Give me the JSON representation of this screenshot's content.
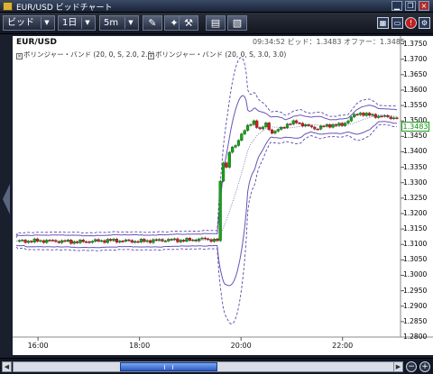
{
  "window": {
    "title": "EUR/USD ビッドチャート",
    "app_icon": "chart-icon",
    "buttons": [
      "minimize-icon",
      "restore-icon",
      "close-icon"
    ]
  },
  "toolbar": {
    "price_type": "ビッド",
    "period": "1日",
    "interval": "5m",
    "tools": [
      "draw-line-icon",
      "pin-icon",
      "indicator-icon",
      "print-icon",
      "image-icon"
    ],
    "right_icons": [
      "layout-icon",
      "window-icon",
      "alert-icon",
      "settings-icon"
    ]
  },
  "chart": {
    "symbol": "EUR/USD",
    "info_time": "09:34:52",
    "info_bid_label": "ビッド：",
    "info_bid": "1.3483",
    "info_offer_label": "オファー：",
    "info_offer": "1.3485",
    "legend_1": "ボリンジャー・バンド (20, 0, S, 2.0, 2.0)",
    "legend_2": "ボリンジャー・バンド (20, 0, S, 3.0, 3.0)",
    "current_price": "1.3483",
    "colors": {
      "background": "#ffffff",
      "up_candle": "#1aa01a",
      "down_candle": "#cc2020",
      "band2": "#6a52b8",
      "band3": "#5a4aa8",
      "middle": "#6a6aa8"
    }
  },
  "chart_data": {
    "type": "candlestick",
    "y_ticks": [
      "1.3750",
      "1.3700",
      "1.3650",
      "1.3600",
      "1.3550",
      "1.3500",
      "1.3450",
      "1.3400",
      "1.3350",
      "1.3300",
      "1.3250",
      "1.3200",
      "1.3150",
      "1.3100",
      "1.3050",
      "1.3000",
      "1.2950",
      "1.2900",
      "1.2850",
      "1.2800"
    ],
    "ylim": [
      1.28,
      1.3775
    ],
    "x_ticks": [
      "16:00",
      "18:00",
      "20:00",
      "22:00"
    ],
    "series": [
      {
        "name": "ボリンジャー・バンド (20, 0, S, 2.0, 2.0)"
      },
      {
        "name": "ボリンジャー・バンド (20, 0, S, 3.0, 3.0)"
      }
    ],
    "close_path": [
      [
        0,
        1.311
      ],
      [
        20,
        1.3112
      ],
      [
        40,
        1.3108
      ],
      [
        60,
        1.3113
      ],
      [
        80,
        1.311
      ],
      [
        100,
        1.3115
      ],
      [
        110,
        1.3113
      ],
      [
        124,
        1.3118
      ],
      [
        132,
        1.3112
      ],
      [
        133,
        1.325
      ],
      [
        134,
        1.33
      ],
      [
        136,
        1.337
      ],
      [
        138,
        1.335
      ],
      [
        140,
        1.34
      ],
      [
        144,
        1.342
      ],
      [
        148,
        1.346
      ],
      [
        152,
        1.348
      ],
      [
        156,
        1.35
      ],
      [
        160,
        1.347
      ],
      [
        164,
        1.349
      ],
      [
        168,
        1.3462
      ],
      [
        172,
        1.347
      ],
      [
        178,
        1.349
      ],
      [
        184,
        1.3496
      ],
      [
        190,
        1.3485
      ],
      [
        196,
        1.3476
      ],
      [
        202,
        1.3482
      ],
      [
        208,
        1.3488
      ],
      [
        214,
        1.3486
      ],
      [
        220,
        1.3512
      ],
      [
        226,
        1.3526
      ],
      [
        232,
        1.3518
      ],
      [
        238,
        1.3516
      ],
      [
        244,
        1.3512
      ],
      [
        250,
        1.351
      ]
    ],
    "current": 1.3483
  }
}
